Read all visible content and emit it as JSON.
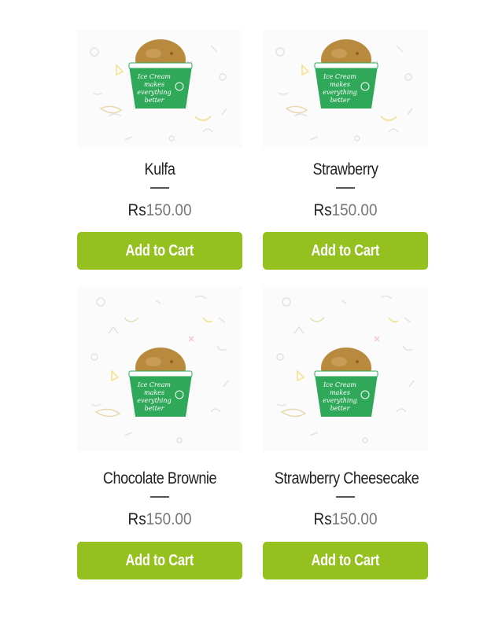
{
  "colors": {
    "button_bg": "#94c11f",
    "button_text": "#ffffff",
    "cup_green": "#2fa85a",
    "ice_cream": "#b98a3e"
  },
  "products": [
    {
      "name": "Kulfa",
      "currency": "Rs",
      "price": "150.00",
      "button_label": "Add to Cart",
      "image_icon": "ice-cream-cup-icon",
      "cup_text": [
        "Ice Cream",
        "makes",
        "everything",
        "better"
      ]
    },
    {
      "name": "Strawberry",
      "currency": "Rs",
      "price": "150.00",
      "button_label": "Add to Cart",
      "image_icon": "ice-cream-cup-icon",
      "cup_text": [
        "Ice Cream",
        "makes",
        "everything",
        "better"
      ]
    },
    {
      "name": "Chocolate Brownie",
      "currency": "Rs",
      "price": "150.00",
      "button_label": "Add to Cart",
      "image_icon": "ice-cream-cup-icon",
      "cup_text": [
        "Ice Cream",
        "makes",
        "everything",
        "better"
      ]
    },
    {
      "name": "Strawberry Cheesecake",
      "currency": "Rs",
      "price": "150.00",
      "button_label": "Add to Cart",
      "image_icon": "ice-cream-cup-icon",
      "cup_text": [
        "Ice Cream",
        "makes",
        "everything",
        "better"
      ]
    }
  ]
}
